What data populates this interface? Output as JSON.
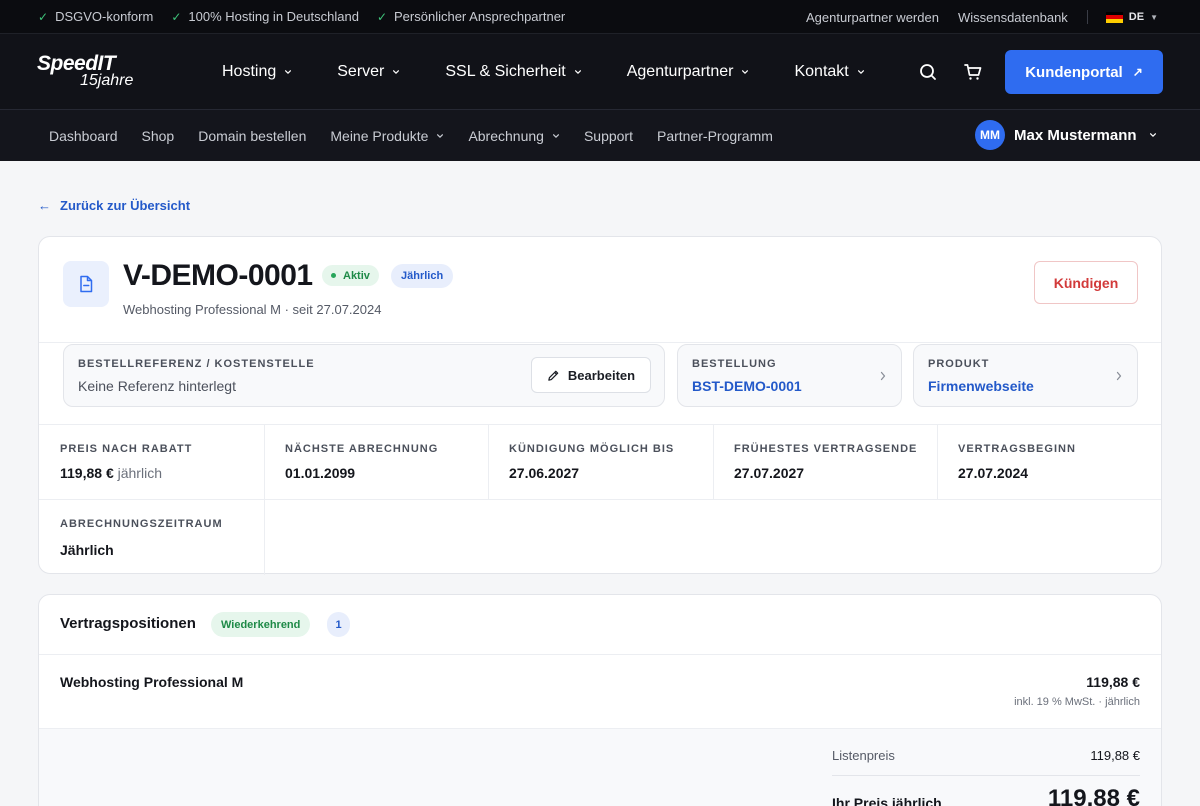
{
  "topbar": {
    "usps": [
      "DSGVO-konform",
      "100% Hosting in Deutschland",
      "Persönlicher Ansprechpartner"
    ],
    "links": [
      "Agenturpartner werden",
      "Wissensdatenbank"
    ],
    "language": "DE"
  },
  "logo": {
    "name": "SpeedIT",
    "tagline": "15jahre"
  },
  "mainnav": {
    "items": [
      "Hosting",
      "Server",
      "SSL & Sicherheit",
      "Agenturpartner",
      "Kontakt"
    ],
    "portal_button": "Kundenportal"
  },
  "subnav": {
    "items": [
      "Dashboard",
      "Shop",
      "Domain bestellen",
      "Meine Produkte",
      "Abrechnung",
      "Support",
      "Partner-Programm"
    ],
    "user_initials": "MM",
    "user_name": "Max Mustermann"
  },
  "back_link": "Zurück zur Übersicht",
  "contract": {
    "id": "V-DEMO-0001",
    "status": "Aktiv",
    "period_badge": "Jährlich",
    "subtitle": "Webhosting Professional M · seit 27.07.2024",
    "cancel_button": "Kündigen",
    "reference": {
      "label": "BESTELLREFERENZ / KOSTENSTELLE",
      "value": "Keine Referenz hinterlegt",
      "edit_button": "Bearbeiten"
    },
    "order": {
      "label": "BESTELLUNG",
      "value": "BST-DEMO-0001"
    },
    "product": {
      "label": "PRODUKT",
      "value": "Firmenwebseite"
    },
    "details": {
      "price": {
        "label": "PREIS NACH RABATT",
        "value": "119,88 €",
        "unit": "jährlich"
      },
      "next_billing": {
        "label": "NÄCHSTE ABRECHNUNG",
        "value": "01.01.2099"
      },
      "cancel_until": {
        "label": "KÜNDIGUNG MÖGLICH BIS",
        "value": "27.06.2027"
      },
      "earliest_end": {
        "label": "FRÜHESTES VERTRAGSENDE",
        "value": "27.07.2027"
      },
      "start": {
        "label": "VERTRAGSBEGINN",
        "value": "27.07.2024"
      },
      "billing_period": {
        "label": "ABRECHNUNGSZEITRAUM",
        "value": "Jährlich"
      }
    }
  },
  "positions": {
    "title": "Vertragspositionen",
    "badge": "Wiederkehrend",
    "count": "1",
    "item": {
      "name": "Webhosting Professional M",
      "price": "119,88 €",
      "tax_note": "inkl. 19 % MwSt. · jährlich"
    },
    "summary": {
      "list_label": "Listenpreis",
      "list_value": "119,88 €",
      "your_label": "Ihr Preis jährlich",
      "your_value": "119,88 €"
    }
  },
  "colors": {
    "accent": "#2f6cf0",
    "link": "#2359c9",
    "success": "#1e8a47",
    "danger": "#d23a3a",
    "dark_bg": "#111218"
  }
}
